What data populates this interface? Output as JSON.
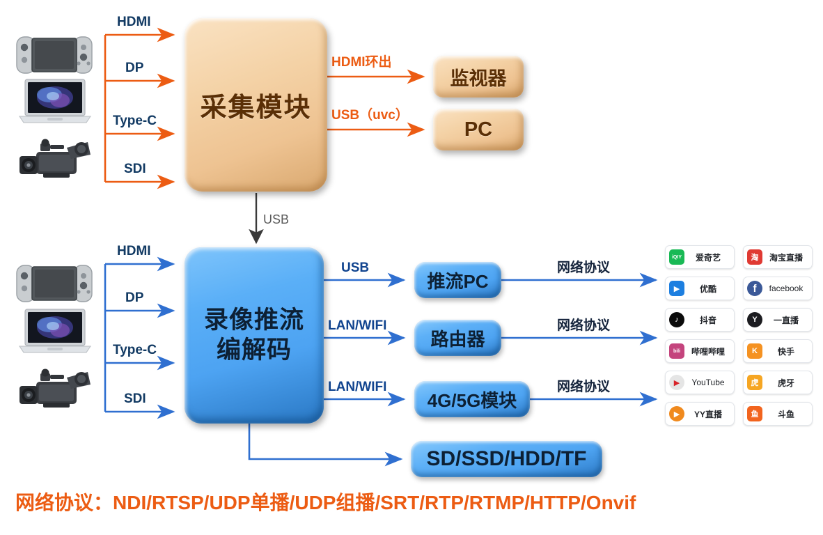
{
  "colors": {
    "orange": "#ec5c13",
    "blue": "#2f6fd0",
    "navy": "#123a63",
    "beige_box": "#f0cfa0",
    "blue_box": "#55a9f5",
    "gray_arrow": "#3a3a3a"
  },
  "top_section": {
    "sources": [
      {
        "icon": "game-console-icon",
        "label": "game console"
      },
      {
        "icon": "laptop-icon",
        "label": "laptop"
      },
      {
        "icon": "camcorder-icon",
        "label": "camcorder"
      }
    ],
    "input_links": [
      {
        "label": "HDMI"
      },
      {
        "label": "DP"
      },
      {
        "label": "Type-C"
      },
      {
        "label": "SDI"
      }
    ],
    "module": {
      "title": "采集模块"
    },
    "outputs": [
      {
        "link": "HDMI环出",
        "target": "监视器"
      },
      {
        "link": "USB（uvc）",
        "target": "PC"
      }
    ]
  },
  "bridge": {
    "label": "USB"
  },
  "bottom_section": {
    "sources": [
      {
        "icon": "game-console-icon",
        "label": "game console"
      },
      {
        "icon": "laptop-icon",
        "label": "laptop"
      },
      {
        "icon": "camcorder-icon",
        "label": "camcorder"
      }
    ],
    "input_links": [
      {
        "label": "HDMI"
      },
      {
        "label": "DP"
      },
      {
        "label": "Type-C"
      },
      {
        "label": "SDI"
      }
    ],
    "module": {
      "line1": "录像推流",
      "line2": "编解码"
    },
    "outputs": [
      {
        "link": "USB",
        "target": "推流PC",
        "onward": "网络协议"
      },
      {
        "link": "LAN/WIFI",
        "target": "路由器",
        "onward": "网络协议"
      },
      {
        "link": "LAN/WIFI",
        "target": "4G/5G模块",
        "onward": "网络协议"
      },
      {
        "link": "",
        "target": "SD/SSD/HDD/TF",
        "onward": ""
      }
    ]
  },
  "platforms": [
    {
      "name": "爱奇艺",
      "icon": "iqiyi-icon",
      "color": "#19b955",
      "glyph": "iQIY",
      "latin": false
    },
    {
      "name": "淘宝直播",
      "icon": "taobao-live-icon",
      "color": "#e03a33",
      "glyph": "淘",
      "latin": false
    },
    {
      "name": "优酷",
      "icon": "youku-icon",
      "color": "#1d7fe0",
      "glyph": "▶",
      "latin": false
    },
    {
      "name": "facebook",
      "icon": "facebook-icon",
      "color": "#3b5998",
      "glyph": "f",
      "latin": true
    },
    {
      "name": "抖音",
      "icon": "douyin-icon",
      "color": "#0b0b0b",
      "glyph": "♪",
      "latin": false
    },
    {
      "name": "一直播",
      "icon": "yizhibo-icon",
      "color": "#1c1c20",
      "glyph": "Y",
      "latin": false
    },
    {
      "name": "哔哩哔哩",
      "icon": "bilibili-icon",
      "color": "#c4447d",
      "glyph": "bili",
      "latin": false
    },
    {
      "name": "快手",
      "icon": "kuaishou-icon",
      "color": "#f59222",
      "glyph": "K",
      "latin": false
    },
    {
      "name": "YouTube",
      "icon": "youtube-icon",
      "color": "#e5e5e5",
      "glyph": "▶",
      "latin": true
    },
    {
      "name": "虎牙",
      "icon": "huya-icon",
      "color": "#f6a623",
      "glyph": "虎",
      "latin": false
    },
    {
      "name": "YY直播",
      "icon": "yy-live-icon",
      "color": "#f08a1e",
      "glyph": "▶",
      "latin": false
    },
    {
      "name": "斗鱼",
      "icon": "douyu-icon",
      "color": "#f2641e",
      "glyph": "鱼",
      "latin": false
    }
  ],
  "footer": {
    "text": "网络协议：NDI/RTSP/UDP单播/UDP组播/SRT/RTP/RTMP/HTTP/Onvif"
  }
}
